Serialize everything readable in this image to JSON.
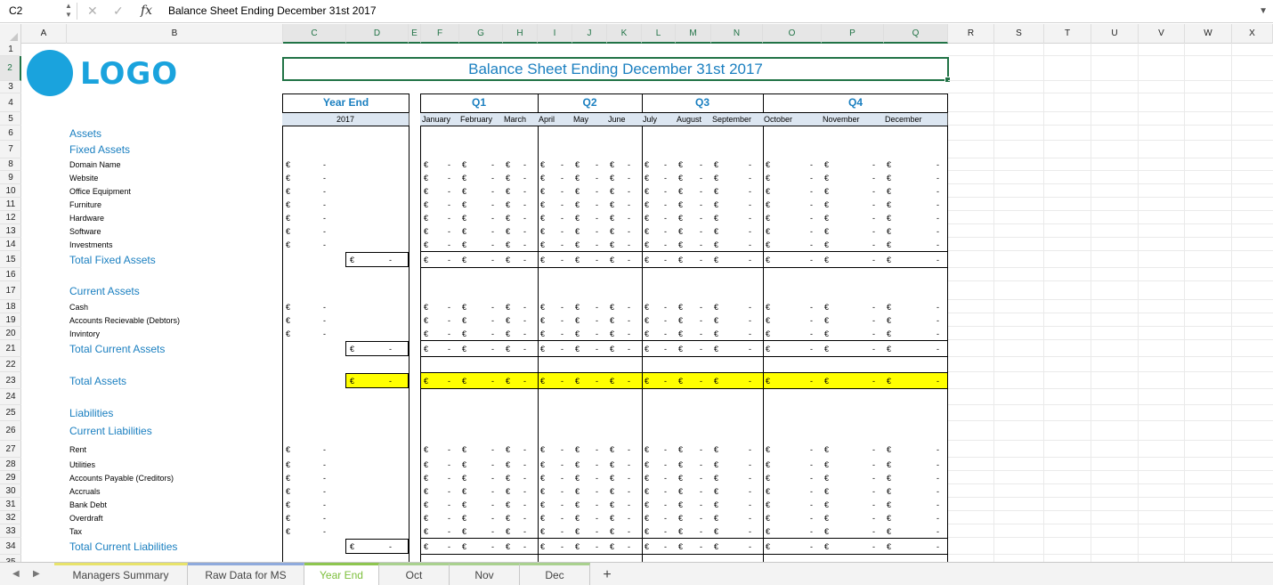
{
  "formula_bar": {
    "cell_ref": "C2",
    "formula_label": "fx",
    "content": "Balance Sheet Ending December 31st 2017"
  },
  "columns": [
    "A",
    "B",
    "C",
    "D",
    "E",
    "F",
    "G",
    "H",
    "I",
    "J",
    "K",
    "L",
    "M",
    "N",
    "O",
    "P",
    "Q",
    "R",
    "S",
    "T",
    "U",
    "V",
    "W",
    "X"
  ],
  "rows": [
    "1",
    "2",
    "3",
    "4",
    "5",
    "6",
    "7",
    "8",
    "9",
    "10",
    "11",
    "12",
    "13",
    "14",
    "15",
    "16",
    "17",
    "18",
    "19",
    "20",
    "21",
    "22",
    "23",
    "24",
    "25",
    "26",
    "27",
    "28",
    "29",
    "30",
    "31",
    "32",
    "33",
    "34",
    "35"
  ],
  "logo": "LOGO",
  "title": "Balance Sheet Ending December 31st 2017",
  "year_end": {
    "label": "Year End",
    "year": "2017"
  },
  "quarters": [
    "Q1",
    "Q2",
    "Q3",
    "Q4"
  ],
  "months": [
    "January",
    "February",
    "March",
    "April",
    "May",
    "June",
    "July",
    "August",
    "September",
    "October",
    "November",
    "December"
  ],
  "currency": "€",
  "dash": "-",
  "labels": {
    "assets": "Assets",
    "fixed_assets": "Fixed Assets",
    "domain_name": "Domain Name",
    "website": "Website",
    "office_equipment": "Office Equipment",
    "furniture": "Furniture",
    "hardware": "Hardware",
    "software": "Software",
    "investments": "Investments",
    "total_fixed_assets": "Total Fixed Assets",
    "current_assets": "Current Assets",
    "cash": "Cash",
    "debtors": "Accounts Recievable (Debtors)",
    "invintory": "Invintory",
    "total_current_assets": "Total Current Assets",
    "total_assets": "Total Assets",
    "liabilities": "Liabilities",
    "current_liabilities": "Current Liabilities",
    "rent": "Rent",
    "utilities": "Utilities",
    "creditors": "Accounts Payable (Creditors)",
    "accruals": "Accruals",
    "bank_debt": "Bank Debt",
    "overdraft": "Overdraft",
    "tax": "Tax",
    "total_current_liabilities": "Total Current Liabilities"
  },
  "sheet_tabs": [
    "Managers Summary",
    "Raw Data for MS",
    "Year End",
    "Oct",
    "Nov",
    "Dec"
  ],
  "active_tab": "Year End",
  "add_sheet": "+",
  "colors": {
    "accent_blue": "#1a7fc0",
    "highlight_yellow": "#ffff00",
    "excel_green": "#217346",
    "month_header_bg": "#dce6f1"
  }
}
